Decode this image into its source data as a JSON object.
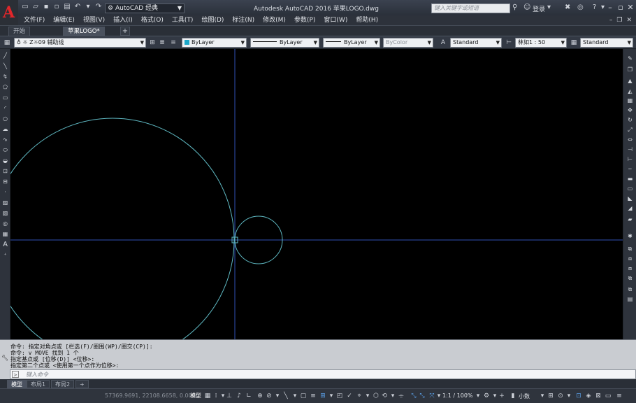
{
  "titlebar": {
    "logo_letter": "A",
    "workspace": "AutoCAD 经典",
    "app_title": "Autodesk AutoCAD 2016    苹果LOGO.dwg",
    "search_placeholder": "键入关键字或短语",
    "signin": "登录"
  },
  "menu": {
    "items": [
      "文件(F)",
      "编辑(E)",
      "视图(V)",
      "插入(I)",
      "格式(O)",
      "工具(T)",
      "绘图(D)",
      "标注(N)",
      "修改(M)",
      "参数(P)",
      "窗口(W)",
      "帮助(H)"
    ]
  },
  "tabs": {
    "start": "开始",
    "drawing": "苹果LOGO*"
  },
  "properties": {
    "layer": "Z☼09 辅助线",
    "color": "ByLayer",
    "linetype": "ByLayer",
    "lineweight": "ByLayer",
    "plotstyle": "ByColor",
    "text_style": "Standard",
    "scale": "林如1 : 50",
    "table_style": "Standard"
  },
  "canvas": {
    "background": "#000000",
    "accent_colors": {
      "circle": "#5fb9c3",
      "axis_line": "#2f4fb3"
    }
  },
  "command": {
    "history": [
      "命令: 指定对角点或 [栏选(F)/圈围(WP)/圈交(CP)]:",
      "命令: v MOVE 找到 1 个",
      "指定基点或 [位移(D)] <位移>:",
      "指定第二个点或 <使用第一个点作为位移>:"
    ],
    "placeholder": "键入命令"
  },
  "layout_tabs": [
    "模型",
    "布局1",
    "布局2"
  ],
  "status": {
    "coordinates": "57369.9691, 22108.6658, 0.0000",
    "model": "模型",
    "annotation_scale": "1:1 / 100%",
    "units": "小数"
  }
}
